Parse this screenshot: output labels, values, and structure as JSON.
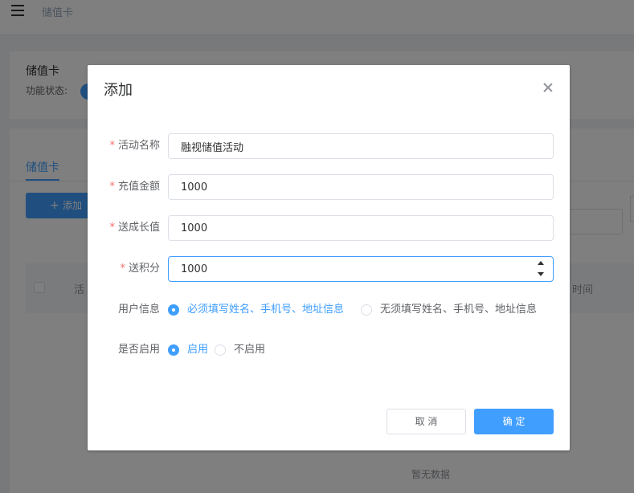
{
  "header": {
    "breadcrumb": "储值卡"
  },
  "page": {
    "card_title": "储值卡",
    "status_label": "功能状态:",
    "tab_label": "储值卡",
    "add_label": "添加",
    "table_col_left": "活",
    "table_col_right": "时间",
    "empty_text": "暂无数据"
  },
  "dialog": {
    "title": "添加",
    "fields": [
      {
        "label": "活动名称",
        "required": "*",
        "value": "融视储值活动"
      },
      {
        "label": "充值金额",
        "required": "*",
        "value": "1000"
      },
      {
        "label": "送成长值",
        "required": "*",
        "value": "1000"
      },
      {
        "label": "送积分",
        "required": "*",
        "value": "1000"
      }
    ],
    "user_info": {
      "label": "用户信息",
      "options": [
        "必须填写姓名、手机号、地址信息",
        "无须填写姓名、手机号、地址信息"
      ],
      "selected": "必须填写姓名、手机号、地址信息"
    },
    "enabled": {
      "label": "是否启用",
      "options": [
        "启用",
        "不启用"
      ],
      "selected": "启用"
    },
    "cancel_label": "取 消",
    "confirm_label": "确 定"
  },
  "colors": {
    "primary": "#409eff",
    "required": "#f56c6c",
    "overlay": "rgba(0,0,0,0.5)"
  },
  "icons": {
    "menu": "hamburger-icon",
    "close": "close-icon",
    "add": "plus-icon"
  }
}
